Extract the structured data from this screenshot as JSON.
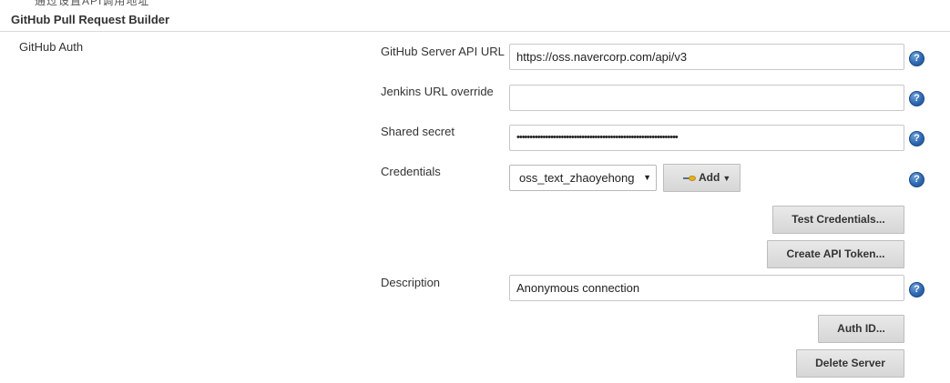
{
  "clipped_header_text": "通过设置API调用地址",
  "section": {
    "title": "GitHub Pull Request Builder",
    "group_label": "GitHub Auth"
  },
  "fields": {
    "server_api_url": {
      "label": "GitHub Server API URL",
      "value": "https://oss.navercorp.com/api/v3"
    },
    "jenkins_url_override": {
      "label": "Jenkins URL override",
      "value": ""
    },
    "shared_secret": {
      "label": "Shared secret",
      "value": "••••••••••••••••••••••••••••••••••••••••••••••••••••••••••••••"
    },
    "credentials": {
      "label": "Credentials",
      "selected": "oss_text_zhaoyehong",
      "arrow": "▼"
    },
    "description": {
      "label": "Description",
      "value": "Anonymous connection"
    }
  },
  "buttons": {
    "add": "Add",
    "add_caret": "▼",
    "test_credentials": "Test Credentials...",
    "create_api_token": "Create API Token...",
    "auth_id": "Auth ID...",
    "delete_server": "Delete Server"
  },
  "help_glyph": "?",
  "icons": {
    "help": "help-icon",
    "key": "key-icon"
  },
  "colors": {
    "help_blue": "#2e69b3",
    "button_bg": "#e0e0e0",
    "border": "#c8c8c8"
  }
}
